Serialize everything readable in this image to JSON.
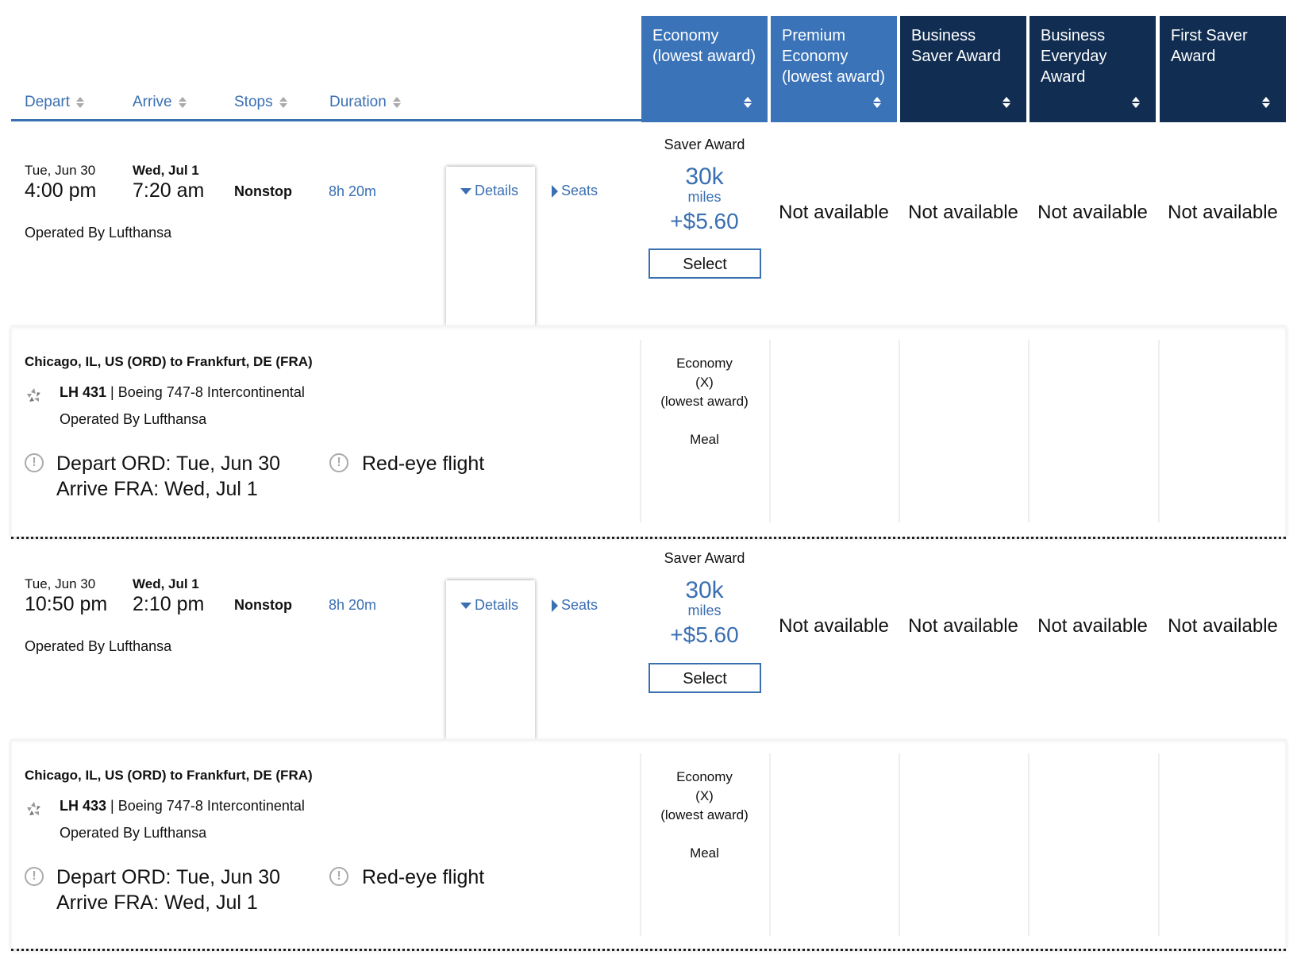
{
  "header": {
    "sort_columns": [
      {
        "label": "Depart"
      },
      {
        "label": "Arrive"
      },
      {
        "label": "Stops"
      },
      {
        "label": "Duration"
      }
    ],
    "fare_columns": [
      {
        "label": "Economy (lowest award)",
        "style": "light"
      },
      {
        "label": "Premium Economy (lowest award)",
        "style": "light"
      },
      {
        "label": "Business Saver Award",
        "style": "dark"
      },
      {
        "label": "Business Everyday Award",
        "style": "dark"
      },
      {
        "label": "First Saver Award",
        "style": "dark"
      }
    ]
  },
  "colors": {
    "accent_blue": "#3a73b8",
    "dark_navy": "#112e52",
    "link_blue": "#3a6fb2"
  },
  "flights": [
    {
      "depart_date": "Tue, Jun 30",
      "depart_time": "4:00 pm",
      "arrive_date": "Wed, Jul 1",
      "arrive_time": "7:20 am",
      "stops": "Nonstop",
      "duration": "8h 20m",
      "operated_by": "Operated By Lufthansa",
      "details_label": "Details",
      "seats_label": "Seats",
      "economy": {
        "fare_type": "Saver Award",
        "miles": "30k",
        "miles_unit": "miles",
        "fee": "+$5.60",
        "select_label": "Select"
      },
      "other_fares": [
        "Not available",
        "Not available",
        "Not available",
        "Not available"
      ],
      "details": {
        "route": "Chicago, IL, US (ORD) to Frankfurt, DE (FRA)",
        "flight_number": "LH 431",
        "separator": "|",
        "aircraft": "Boeing 747-8 Intercontinental",
        "operated_by": "Operated By Lufthansa",
        "depart_notice": "Depart ORD: Tue, Jun 30",
        "arrive_notice": "Arrive FRA: Wed, Jul 1",
        "redeye_notice": "Red-eye flight",
        "cabin_lines": [
          "Economy",
          "(X)",
          "(lowest award)"
        ],
        "meal": "Meal"
      }
    },
    {
      "depart_date": "Tue, Jun 30",
      "depart_time": "10:50 pm",
      "arrive_date": "Wed, Jul 1",
      "arrive_time": "2:10 pm",
      "stops": "Nonstop",
      "duration": "8h 20m",
      "operated_by": "Operated By Lufthansa",
      "details_label": "Details",
      "seats_label": "Seats",
      "economy": {
        "fare_type": "Saver Award",
        "miles": "30k",
        "miles_unit": "miles",
        "fee": "+$5.60",
        "select_label": "Select"
      },
      "other_fares": [
        "Not available",
        "Not available",
        "Not available",
        "Not available"
      ],
      "details": {
        "route": "Chicago, IL, US (ORD) to Frankfurt, DE (FRA)",
        "flight_number": "LH 433",
        "separator": "|",
        "aircraft": "Boeing 747-8 Intercontinental",
        "operated_by": "Operated By Lufthansa",
        "depart_notice": "Depart ORD: Tue, Jun 30",
        "arrive_notice": "Arrive FRA: Wed, Jul 1",
        "redeye_notice": "Red-eye flight",
        "cabin_lines": [
          "Economy",
          "(X)",
          "(lowest award)"
        ],
        "meal": "Meal"
      }
    }
  ]
}
